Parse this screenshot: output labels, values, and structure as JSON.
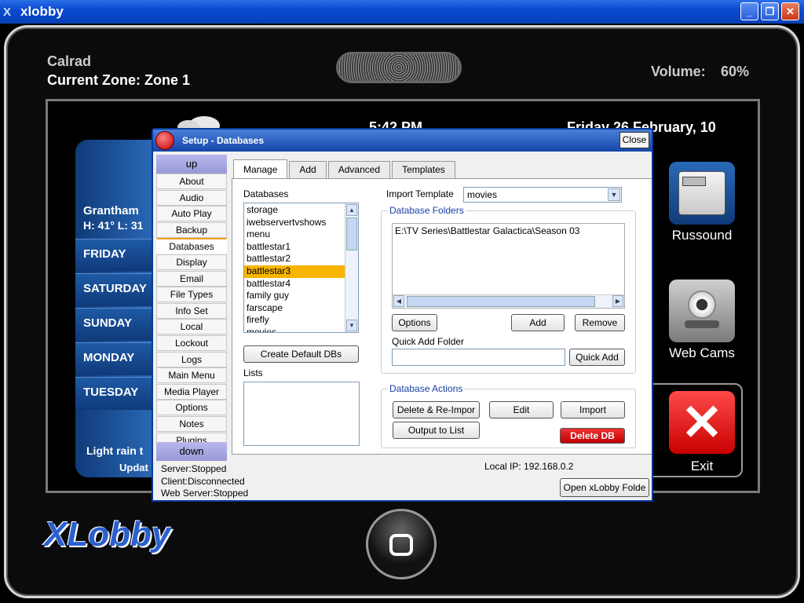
{
  "window": {
    "title": "xlobby"
  },
  "device": {
    "user": "Calrad",
    "zone": "Current Zone: Zone 1",
    "volume_label": "Volume:",
    "volume_value": "60%",
    "time": "5:42 PM",
    "date": "Friday 26 February, 10",
    "logo": "XLobby"
  },
  "weather": {
    "city": "Grantham",
    "temps": "H: 41°  L: 31",
    "days": [
      "FRIDAY",
      "SATURDAY",
      "SUNDAY",
      "MONDAY",
      "TUESDAY"
    ],
    "condition": "Light rain t",
    "updated": "Updat"
  },
  "apps": [
    {
      "label": "Russound",
      "icon": "remote-control-icon"
    },
    {
      "label": "Web Cams",
      "icon": "webcam-icon"
    },
    {
      "label": "Exit",
      "icon": "exit-x-icon"
    }
  ],
  "dialog": {
    "title": "Setup - Databases",
    "close_label": "Close",
    "nav_up": "up",
    "nav_down": "down",
    "nav_items": [
      "About",
      "Audio",
      "Auto Play",
      "Backup",
      "Databases",
      "Display",
      "Email",
      "File Types",
      "Info Set",
      "Local",
      "Lockout",
      "Logs",
      "Main Menu",
      "Media Player",
      "Options",
      "Notes",
      "Plugins"
    ],
    "active_nav": "Databases",
    "tabs": [
      "Manage",
      "Add",
      "Advanced",
      "Templates"
    ],
    "databases_label": "Databases",
    "databases": [
      "storage",
      "iwebservertvshows",
      "menu",
      "battlestar1",
      "battlestar2",
      "battlestar3",
      "battlestar4",
      "family guy",
      "farscape",
      "firefly",
      "movies"
    ],
    "selected_db": "battlestar3",
    "create_default_label": "Create Default DBs",
    "lists_label": "Lists",
    "import_template_label": "Import Template",
    "import_template_value": "movies",
    "folders_group": "Database Folders",
    "folders": [
      "E:\\TV Series\\Battlestar Galactica\\Season 03"
    ],
    "options_label": "Options",
    "add_label": "Add",
    "remove_label": "Remove",
    "quick_add_label": "Quick Add Folder",
    "quick_add_value": "",
    "quick_add_button": "Quick Add",
    "actions_group": "Database Actions",
    "delete_reimport_label": "Delete & Re-Impor",
    "edit_label": "Edit",
    "import_label": "Import",
    "output_list_label": "Output to List",
    "delete_db_label": "Delete DB",
    "status": {
      "server": "Server:Stopped",
      "client": "Client:Disconnected",
      "web": "Web Server:Stopped"
    },
    "local_ip": "Local IP: 192.168.0.2",
    "open_folder_label": "Open xLobby Folde"
  },
  "colors": {
    "titlebar": "#0a4ad0",
    "accent_blue": "#1e5aa6",
    "selection": "#f8b500",
    "delete": "#d00000"
  }
}
